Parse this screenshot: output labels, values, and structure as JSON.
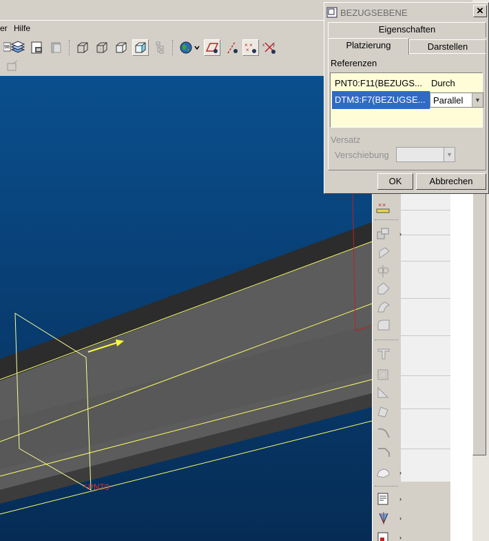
{
  "menubar": {
    "items": [
      "er",
      "Hilfe"
    ]
  },
  "viewport": {
    "point_label": "PNT0",
    "colors": {
      "bg_top": "#0a4f8e",
      "bg_bottom": "#062c55",
      "beam_top": "#2c2c2c",
      "beam_side": "#5e5e5e",
      "datum": "#ffff66",
      "point": "#e03030"
    }
  },
  "dialog": {
    "title": "BEZUGSEBENE",
    "close": "✕",
    "tabs": {
      "properties": "Eigenschaften",
      "placement": "Platzierung",
      "display": "Darstellen"
    },
    "references_label": "Referenzen",
    "references": [
      {
        "name": "PNT0:F11(BEZUGS...",
        "type": "Durch"
      },
      {
        "name": "DTM3:F7(BEZUGSE...",
        "type": "Parallel"
      }
    ],
    "offset_label": "Versatz",
    "translation_label": "Verschiebung",
    "ok": "OK",
    "cancel": "Abbrechen"
  }
}
